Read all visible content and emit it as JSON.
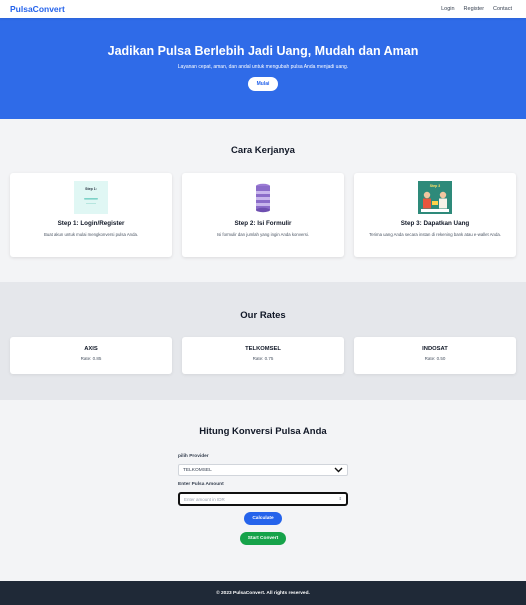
{
  "nav": {
    "brand": "PulsaConvert",
    "links": [
      "Login",
      "Register",
      "Contact"
    ]
  },
  "hero": {
    "title": "Jadikan Pulsa Berlebih Jadi Uang, Mudah dan Aman",
    "subtitle": "Layanan cepat, aman, dan andal untuk mengubah pulsa Anda menjadi uang.",
    "cta": "Mulai"
  },
  "how": {
    "title": "Cara Kerjanya",
    "steps": [
      {
        "title": "Step 1: Login/Register",
        "desc": "Buat akun untuk mulai mengkonversi pulsa Anda.",
        "image_text": "Step 1:"
      },
      {
        "title": "Step 2: Isi Formulir",
        "desc": "Isi formulir dan jumlah yang ingin Anda konversi."
      },
      {
        "title": "Step 3: Dapatkan Uang",
        "desc": "Terima uang Anda secara instan di rekening bank atau e-wallet Anda.",
        "image_text": "Step 3"
      }
    ]
  },
  "rates": {
    "title": "Our Rates",
    "items": [
      {
        "name": "AXIS",
        "rate": "Rate: 0.85"
      },
      {
        "name": "TELKOMSEL",
        "rate": "Rate: 0.75"
      },
      {
        "name": "INDOSAT",
        "rate": "Rate: 0.50"
      }
    ]
  },
  "calc": {
    "title": "Hitung Konversi Pulsa Anda",
    "provider_label": "pilih Provider",
    "provider_value": "TELKOMSEL",
    "amount_label": "Enter Pulsa Amount",
    "amount_placeholder": "Enter amount in IDR",
    "calculate": "Calculate",
    "start": "Start Convert"
  },
  "footer": "© 2023 PulsaConvert. All rights reserved.",
  "colors": {
    "primary": "#2563eb",
    "hero": "#2f6be8",
    "success": "#16a34a",
    "footer": "#1f2937"
  }
}
